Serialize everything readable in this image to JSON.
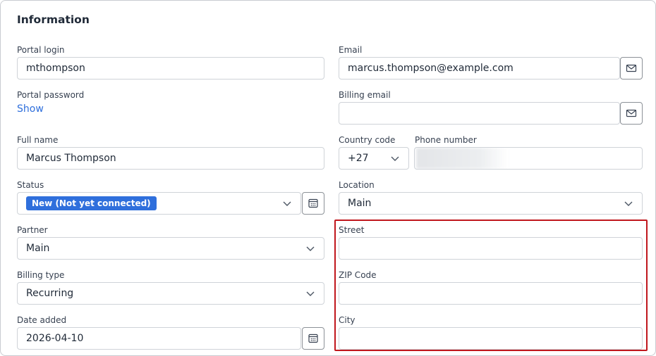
{
  "section": {
    "title": "Information"
  },
  "left": {
    "portal_login": {
      "label": "Portal login",
      "value": "mthompson"
    },
    "portal_password": {
      "label": "Portal password",
      "link": "Show"
    },
    "full_name": {
      "label": "Full name",
      "value": "Marcus Thompson"
    },
    "status": {
      "label": "Status",
      "value": "New (Not yet connected)"
    },
    "partner": {
      "label": "Partner",
      "value": "Main"
    },
    "billing_type": {
      "label": "Billing type",
      "value": "Recurring"
    },
    "date_added": {
      "label": "Date added",
      "value": "2026-04-10"
    }
  },
  "right": {
    "email": {
      "label": "Email",
      "value": "marcus.thompson@example.com"
    },
    "billing_email": {
      "label": "Billing email",
      "value": ""
    },
    "country_code": {
      "label": "Country code",
      "value": "+27"
    },
    "phone_number": {
      "label": "Phone number",
      "value": ""
    },
    "location": {
      "label": "Location",
      "value": "Main"
    },
    "street": {
      "label": "Street",
      "value": ""
    },
    "zip_code": {
      "label": "ZIP Code",
      "value": ""
    },
    "city": {
      "label": "City",
      "value": ""
    }
  },
  "colors": {
    "accent": "#2f6fdc",
    "highlight": "#c0171d",
    "border": "#cfd3d8"
  },
  "icons": [
    "envelope-icon",
    "calendar-icon",
    "chevron-down-icon"
  ]
}
